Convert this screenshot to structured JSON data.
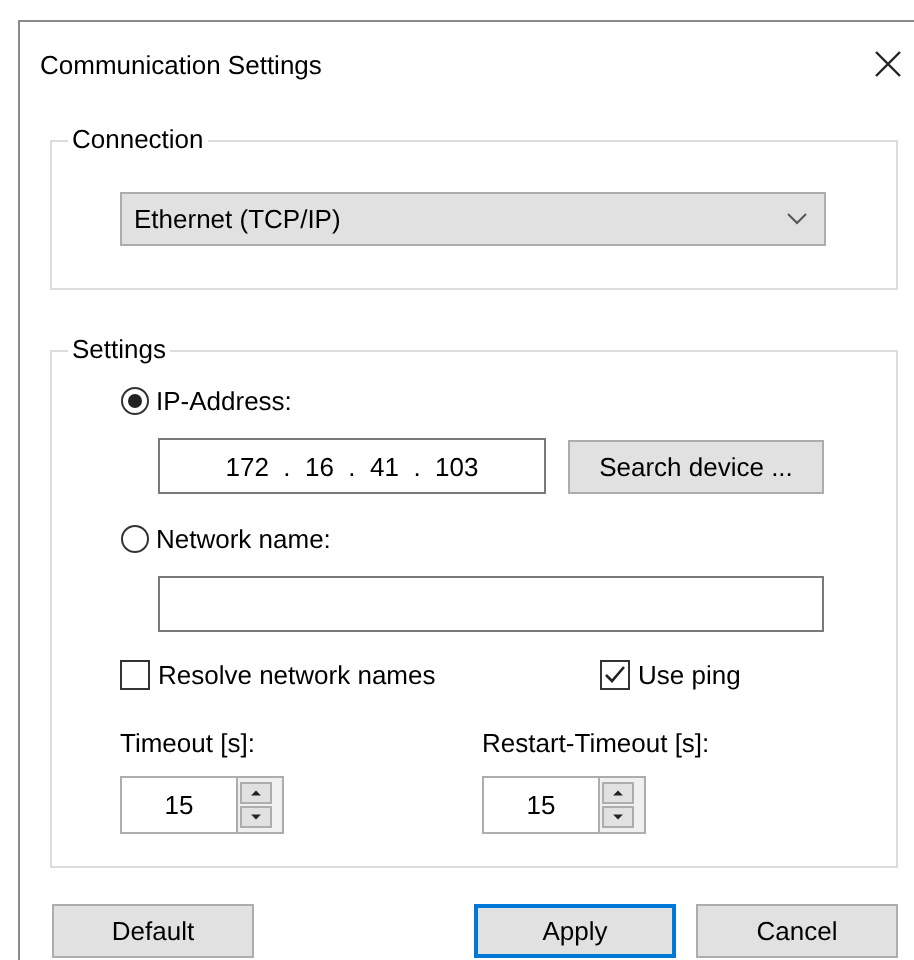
{
  "window": {
    "title": "Communication Settings"
  },
  "connection": {
    "legend": "Connection",
    "value": "Ethernet (TCP/IP)"
  },
  "settings": {
    "legend": "Settings",
    "address_modes": [
      {
        "label": "IP-Address:",
        "selected": true,
        "kind": "ip",
        "value": "172  .  16  .  41  .  103"
      },
      {
        "label": "Network name:",
        "selected": false,
        "kind": "text"
      }
    ],
    "search_button": "Search device ...",
    "options": [
      {
        "label": "Resolve network names",
        "checked": false
      },
      {
        "label": "Use ping",
        "checked": true
      }
    ],
    "timeouts": [
      {
        "label": "Timeout [s]:",
        "value": "15"
      },
      {
        "label": "Restart-Timeout [s]:",
        "value": "15"
      }
    ]
  },
  "buttons": [
    {
      "label": "Default",
      "default": false
    },
    {
      "label": "Apply",
      "default": true
    },
    {
      "label": "Cancel",
      "default": false
    }
  ]
}
